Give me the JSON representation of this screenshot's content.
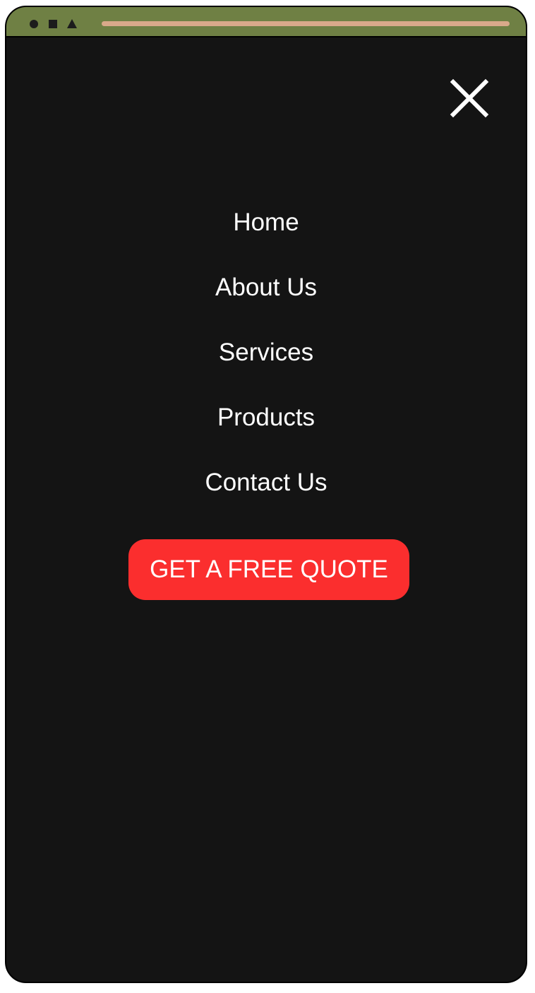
{
  "window": {
    "controls": [
      "circle-icon",
      "square-icon",
      "triangle-icon"
    ],
    "titlebar_color": "#6f8044",
    "address_bar_color": "#d9a98a"
  },
  "menu": {
    "close_icon": "close-icon",
    "items": [
      {
        "label": "Home"
      },
      {
        "label": "About Us"
      },
      {
        "label": "Services"
      },
      {
        "label": "Products"
      },
      {
        "label": "Contact Us"
      }
    ],
    "cta_label": "GET A FREE QUOTE",
    "cta_color": "#fb2e2e",
    "background_color": "#141414"
  }
}
